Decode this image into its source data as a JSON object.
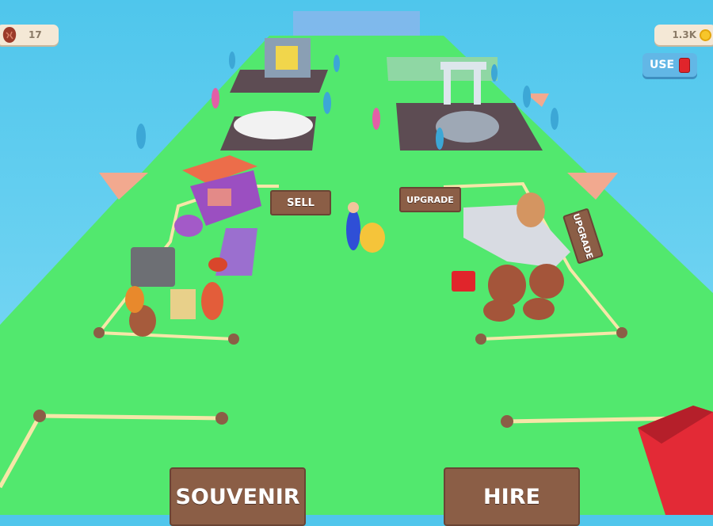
{
  "hud": {
    "relic_count": "17",
    "coin_count": "1.3K",
    "use_label": "USE"
  },
  "signs": {
    "sell": "SELL",
    "upgrade_center": "UPGRADE",
    "upgrade_side": "UPGRADE",
    "souvenir": "SOUVENIR",
    "hire": "HIRE"
  },
  "colors": {
    "sky": "#4fc6ec",
    "ground": "#52e86e",
    "sign_wood": "#8b5e46",
    "hud_panel": "#f4e8d6",
    "use_button": "#62b7e6",
    "accent_red": "#e0252b",
    "coin": "#f7c62a"
  },
  "icons": {
    "relic": "fossil-egg-icon",
    "coin": "gold-coin-icon",
    "use": "red-jerrycan-icon"
  }
}
